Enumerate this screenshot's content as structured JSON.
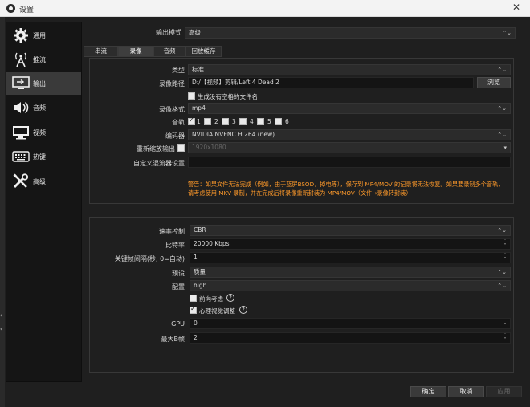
{
  "window": {
    "title": "设置",
    "close_glyph": "✕"
  },
  "sidebar": {
    "items": [
      {
        "label": "通用",
        "icon": "gear-icon",
        "active": false
      },
      {
        "label": "推流",
        "icon": "broadcast-icon",
        "active": false
      },
      {
        "label": "输出",
        "icon": "output-icon",
        "active": true
      },
      {
        "label": "音频",
        "icon": "speaker-icon",
        "active": false
      },
      {
        "label": "视频",
        "icon": "monitor-icon",
        "active": false
      },
      {
        "label": "热键",
        "icon": "keyboard-icon",
        "active": false
      },
      {
        "label": "高级",
        "icon": "tools-icon",
        "active": false
      }
    ]
  },
  "output_mode": {
    "label": "输出模式",
    "value": "高级"
  },
  "tabs": [
    "串流",
    "录像",
    "音频",
    "回放缓存"
  ],
  "recording": {
    "type": {
      "label": "类型",
      "value": "标准"
    },
    "path": {
      "label": "录像路径",
      "value": "D:/【视频】剪辑/Left 4 Dead 2",
      "browse": "浏览"
    },
    "no_space_filename": {
      "label": "生成没有空格的文件名",
      "checked": false
    },
    "format": {
      "label": "录像格式",
      "value": "mp4"
    },
    "tracks": {
      "label": "音轨",
      "items": [
        {
          "n": "1",
          "checked": true
        },
        {
          "n": "2",
          "checked": false
        },
        {
          "n": "3",
          "checked": false
        },
        {
          "n": "4",
          "checked": false
        },
        {
          "n": "5",
          "checked": false
        },
        {
          "n": "6",
          "checked": false
        }
      ]
    },
    "encoder": {
      "label": "编码器",
      "value": "NVIDIA NVENC H.264 (new)"
    },
    "rescale": {
      "label": "重新缩放输出",
      "value": "1920x1080",
      "checked": false
    },
    "custom_muxer": {
      "label": "自定义混流器设置",
      "value": ""
    },
    "warning": "警告：如果文件无法完成（例如，由于蓝屏BSOD，掉电等），保存到 MP4/MOV 的记录将无法恢复。如果要录制多个音轨，请考虑使用 MKV 录制，并在完成后将录像重新封装为 MP4/MOV（文件→录像转封装）"
  },
  "encoder_settings": {
    "rate_control": {
      "label": "速率控制",
      "value": "CBR"
    },
    "bitrate": {
      "label": "比特率",
      "value": "20000 Kbps"
    },
    "keyframe": {
      "label": "关键帧间隔(秒, 0=自动)",
      "value": "1"
    },
    "preset": {
      "label": "预设",
      "value": "质量"
    },
    "profile": {
      "label": "配置",
      "value": "high"
    },
    "lookahead": {
      "label": "前向考虑",
      "checked": false
    },
    "psycho": {
      "label": "心理视觉调整",
      "checked": true
    },
    "gpu": {
      "label": "GPU",
      "value": "0"
    },
    "max_b": {
      "label": "最大B帧",
      "value": "2"
    }
  },
  "buttons": {
    "ok": "确定",
    "cancel": "取消",
    "apply": "应用"
  },
  "glyphs": {
    "down": "▾",
    "updown": "⌃⌄",
    "up": "˄",
    "dn": "˅",
    "help": "?"
  }
}
